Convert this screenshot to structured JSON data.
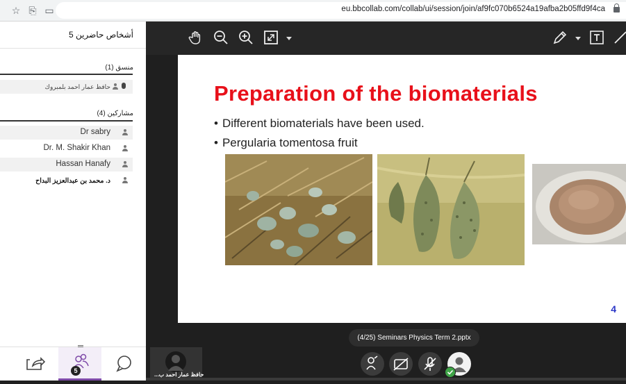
{
  "browser": {
    "url": "eu.bbcollab.com/collab/ui/session/join/af9fc070b6524a19afba2b05ffd9f4ca",
    "icons": [
      "star-icon",
      "tab-search-icon",
      "cast-icon",
      "lock-icon"
    ]
  },
  "sidebar": {
    "title": "5 أشخاص حاضرين",
    "moderator_header": "منسق (1)",
    "moderators": [
      {
        "name": "حافظ عمار احمد بلمبروك"
      }
    ],
    "participants_header": "مشاركين (4)",
    "participants": [
      {
        "name": "Dr sabry"
      },
      {
        "name": "Dr. M. Shakir Khan"
      },
      {
        "name": "Hassan Hanafy"
      },
      {
        "name": "د. محمد بن عبدالعزيز البداح"
      }
    ],
    "attendee_count": "5"
  },
  "slide": {
    "title": "Preparation of the biomaterials",
    "bullets": [
      "Different biomaterials have been used.",
      "Pergularia tomentosa fruit"
    ],
    "page_number": "4"
  },
  "bottom": {
    "file_label": "(4/25)   Seminars Physics Term 2.pptx",
    "tile_name": "حافظ عمار احمد ب..."
  },
  "colors": {
    "title_red": "#e8101a",
    "accent_purple": "#7e4aa8",
    "status_green": "#3fa447",
    "page_blue": "#2b36c7"
  }
}
